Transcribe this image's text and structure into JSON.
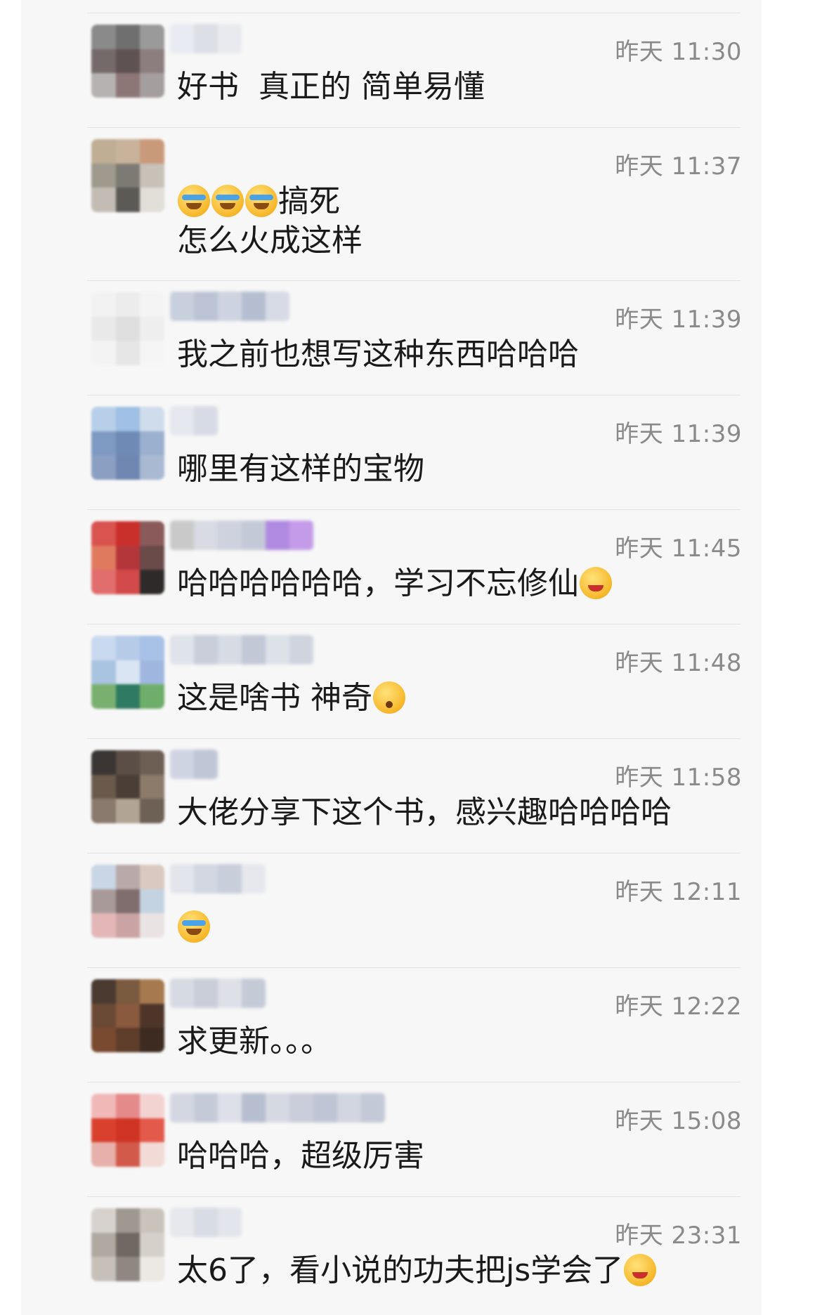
{
  "comments": [
    {
      "time": "昨天 11:30",
      "line1": "好书  真正的 简单易懂",
      "line2": "",
      "emoji_after": "",
      "emoji_before": "",
      "avatar_colors": [
        "#8a8a8a",
        "#6f6f6f",
        "#9a9a9a",
        "#756a6a",
        "#5f5252",
        "#8c7e7e",
        "#b7b2b2",
        "#8d7676",
        "#a59e9e"
      ],
      "nick_colors": [
        "#e8ebf1",
        "#dcdfe6",
        "#e9eaef"
      ]
    },
    {
      "time": "昨天 11:37",
      "line1": "搞死",
      "line2": "怎么火成这样",
      "emoji_after": "",
      "emoji_before": "crying-laughing x3",
      "avatar_colors": [
        "#bfae93",
        "#c8b39a",
        "#c99a7a",
        "#9f9a8d",
        "#7d7a73",
        "#c8c1b8",
        "#c2bcb4",
        "#5c5a55",
        "#e1ddd7"
      ],
      "nick_colors": []
    },
    {
      "time": "昨天 11:39",
      "line1": "我之前也想写这种东西哈哈哈",
      "line2": "",
      "emoji_after": "",
      "emoji_before": "",
      "avatar_colors": [
        "#f2f2f2",
        "#ececec",
        "#f4f4f4",
        "#e9e9e9",
        "#dedede",
        "#eeeeee",
        "#f3f3f3",
        "#e6e6e6",
        "#f5f5f5"
      ],
      "nick_colors": [
        "#c8cfdd",
        "#bcc4d5",
        "#cdd3e0",
        "#b5bed0",
        "#d6dbe6"
      ]
    },
    {
      "time": "昨天 11:39",
      "line1": "哪里有这样的宝物",
      "line2": "",
      "emoji_after": "",
      "emoji_before": "",
      "avatar_colors": [
        "#b7cfe8",
        "#9fbfe4",
        "#cfdcec",
        "#7e9ac2",
        "#6f8ab5",
        "#9bb0cf",
        "#8a9fc1",
        "#6f86b1",
        "#a9b9d2"
      ],
      "nick_colors": [
        "#e4e7ee",
        "#d7dbe5"
      ]
    },
    {
      "time": "昨天 11:45",
      "line1": "哈哈哈哈哈哈，学习不忘修仙",
      "line2": "",
      "emoji_after": "grin",
      "emoji_before": "",
      "avatar_colors": [
        "#d9534f",
        "#c9302c",
        "#8a5a5a",
        "#e07a5f",
        "#b5363a",
        "#6b4a4a",
        "#e26d6d",
        "#d34a4a",
        "#2f2a2a"
      ],
      "nick_colors": [
        "#c9c9c9",
        "#d8dbe3",
        "#cdd2de",
        "#c4c9d8",
        "#b08ae0",
        "#c39be8"
      ]
    },
    {
      "time": "昨天 11:48",
      "line1": "这是啥书 神奇",
      "line2": "",
      "emoji_after": "huh",
      "emoji_before": "",
      "avatar_colors": [
        "#c9d9ef",
        "#b5cbe8",
        "#a8c1e6",
        "#a9c4e0",
        "#d9e5f2",
        "#9fb7df",
        "#79b06f",
        "#2f7a62",
        "#6fae6a"
      ],
      "nick_colors": [
        "#dfe3ea",
        "#c9ceda",
        "#d6dbe4",
        "#c2c8d6",
        "#dde1e8",
        "#cfd4df"
      ]
    },
    {
      "time": "昨天 11:58",
      "line1": "大佬分享下这个书，感兴趣哈哈哈哈",
      "line2": "",
      "emoji_after": "",
      "emoji_before": "",
      "avatar_colors": [
        "#3b3634",
        "#5a4e46",
        "#6e5f55",
        "#6b5a4c",
        "#4a3e36",
        "#8c7a6b",
        "#8a7a6e",
        "#b2a494",
        "#6d6055"
      ],
      "nick_colors": [
        "#cfd4e2",
        "#c0c6d6"
      ]
    },
    {
      "time": "昨天 12:11",
      "line1": "",
      "line2": "",
      "emoji_after": "",
      "emoji_before": "crying-laughing",
      "avatar_colors": [
        "#c9d6e6",
        "#b9a9a9",
        "#d9c9c0",
        "#a99a9a",
        "#7f6d6d",
        "#c4d3e2",
        "#e3b7b7",
        "#caa4a4",
        "#e9e3e3"
      ],
      "nick_colors": [
        "#e2e5eb",
        "#d2d7e1",
        "#c8ceda",
        "#e6e8ee"
      ]
    },
    {
      "time": "昨天 12:22",
      "line1": "求更新。。。",
      "line2": "",
      "emoji_after": "",
      "emoji_before": "",
      "avatar_colors": [
        "#4a3a30",
        "#7a5a3e",
        "#a7794f",
        "#6b4a35",
        "#8a5a3f",
        "#4e3529",
        "#7a4a30",
        "#5e3d2a",
        "#3d2b22"
      ],
      "nick_colors": [
        "#d6dae3",
        "#c9ced9",
        "#dde0e7",
        "#c4cad6"
      ]
    },
    {
      "time": "昨天 15:08",
      "line1": "哈哈哈，超级厉害",
      "line2": "",
      "emoji_after": "",
      "emoji_before": "",
      "avatar_colors": [
        "#f1b8b8",
        "#e58a8a",
        "#f3d2d2",
        "#d9412e",
        "#cf3324",
        "#e35a4a",
        "#e7b0aa",
        "#d25a4a",
        "#f2dad6"
      ],
      "nick_colors": [
        "#d3d7e1",
        "#c4cad7",
        "#dde0e8",
        "#b7bed0",
        "#d5d9e2",
        "#c9ceda",
        "#bfc5d4",
        "#d1d5df",
        "#c3c9d6"
      ]
    },
    {
      "time": "昨天 23:31",
      "line1": "太6了，看小说的功夫把js学会了",
      "line2": "",
      "emoji_after": "grin",
      "emoji_before": "",
      "avatar_colors": [
        "#d7d2cd",
        "#9f9891",
        "#c9c3bc",
        "#b0a9a2",
        "#6f6862",
        "#d6d0ca",
        "#c7c0b9",
        "#8f8780",
        "#ece8e4"
      ],
      "nick_colors": [
        "#e6e8ee",
        "#d8dce4",
        "#e2e5eb"
      ]
    }
  ]
}
